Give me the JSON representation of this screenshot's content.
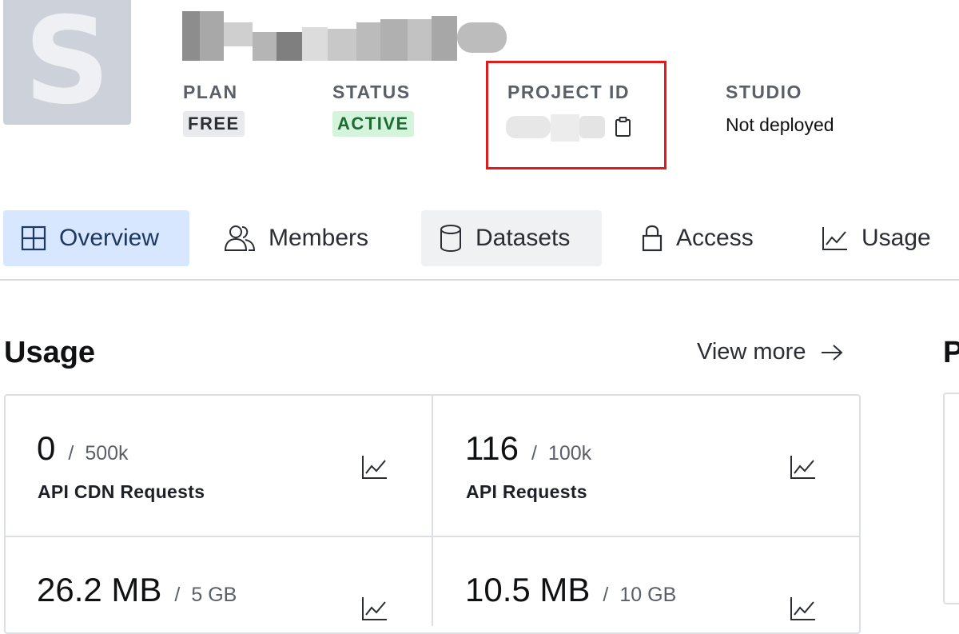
{
  "project": {
    "avatar_letter": "S",
    "meta": {
      "plan_label": "PLAN",
      "plan_value": "FREE",
      "status_label": "STATUS",
      "status_value": "ACTIVE",
      "project_id_label": "PROJECT ID",
      "studio_label": "STUDIO",
      "studio_value": "Not deployed"
    }
  },
  "tabs": [
    {
      "label": "Overview",
      "icon": "grid-icon",
      "active": true
    },
    {
      "label": "Members",
      "icon": "users-icon"
    },
    {
      "label": "Datasets",
      "icon": "database-icon"
    },
    {
      "label": "Access",
      "icon": "lock-icon"
    },
    {
      "label": "Usage",
      "icon": "chart-icon"
    }
  ],
  "usage": {
    "title": "Usage",
    "view_more": "View more",
    "cards": [
      {
        "value": "0",
        "limit": "500k",
        "label": "API CDN Requests"
      },
      {
        "value": "116",
        "limit": "100k",
        "label": "API Requests"
      },
      {
        "value": "26.2 MB",
        "limit": "5 GB",
        "label": ""
      },
      {
        "value": "10.5 MB",
        "limit": "10 GB",
        "label": ""
      }
    ]
  },
  "side_panel": {
    "title_letter": "P"
  },
  "colors": {
    "accent_tab_bg": "#d6e7ff",
    "active_badge_bg": "#d4f5dc",
    "highlight_border": "#e01b1b"
  }
}
